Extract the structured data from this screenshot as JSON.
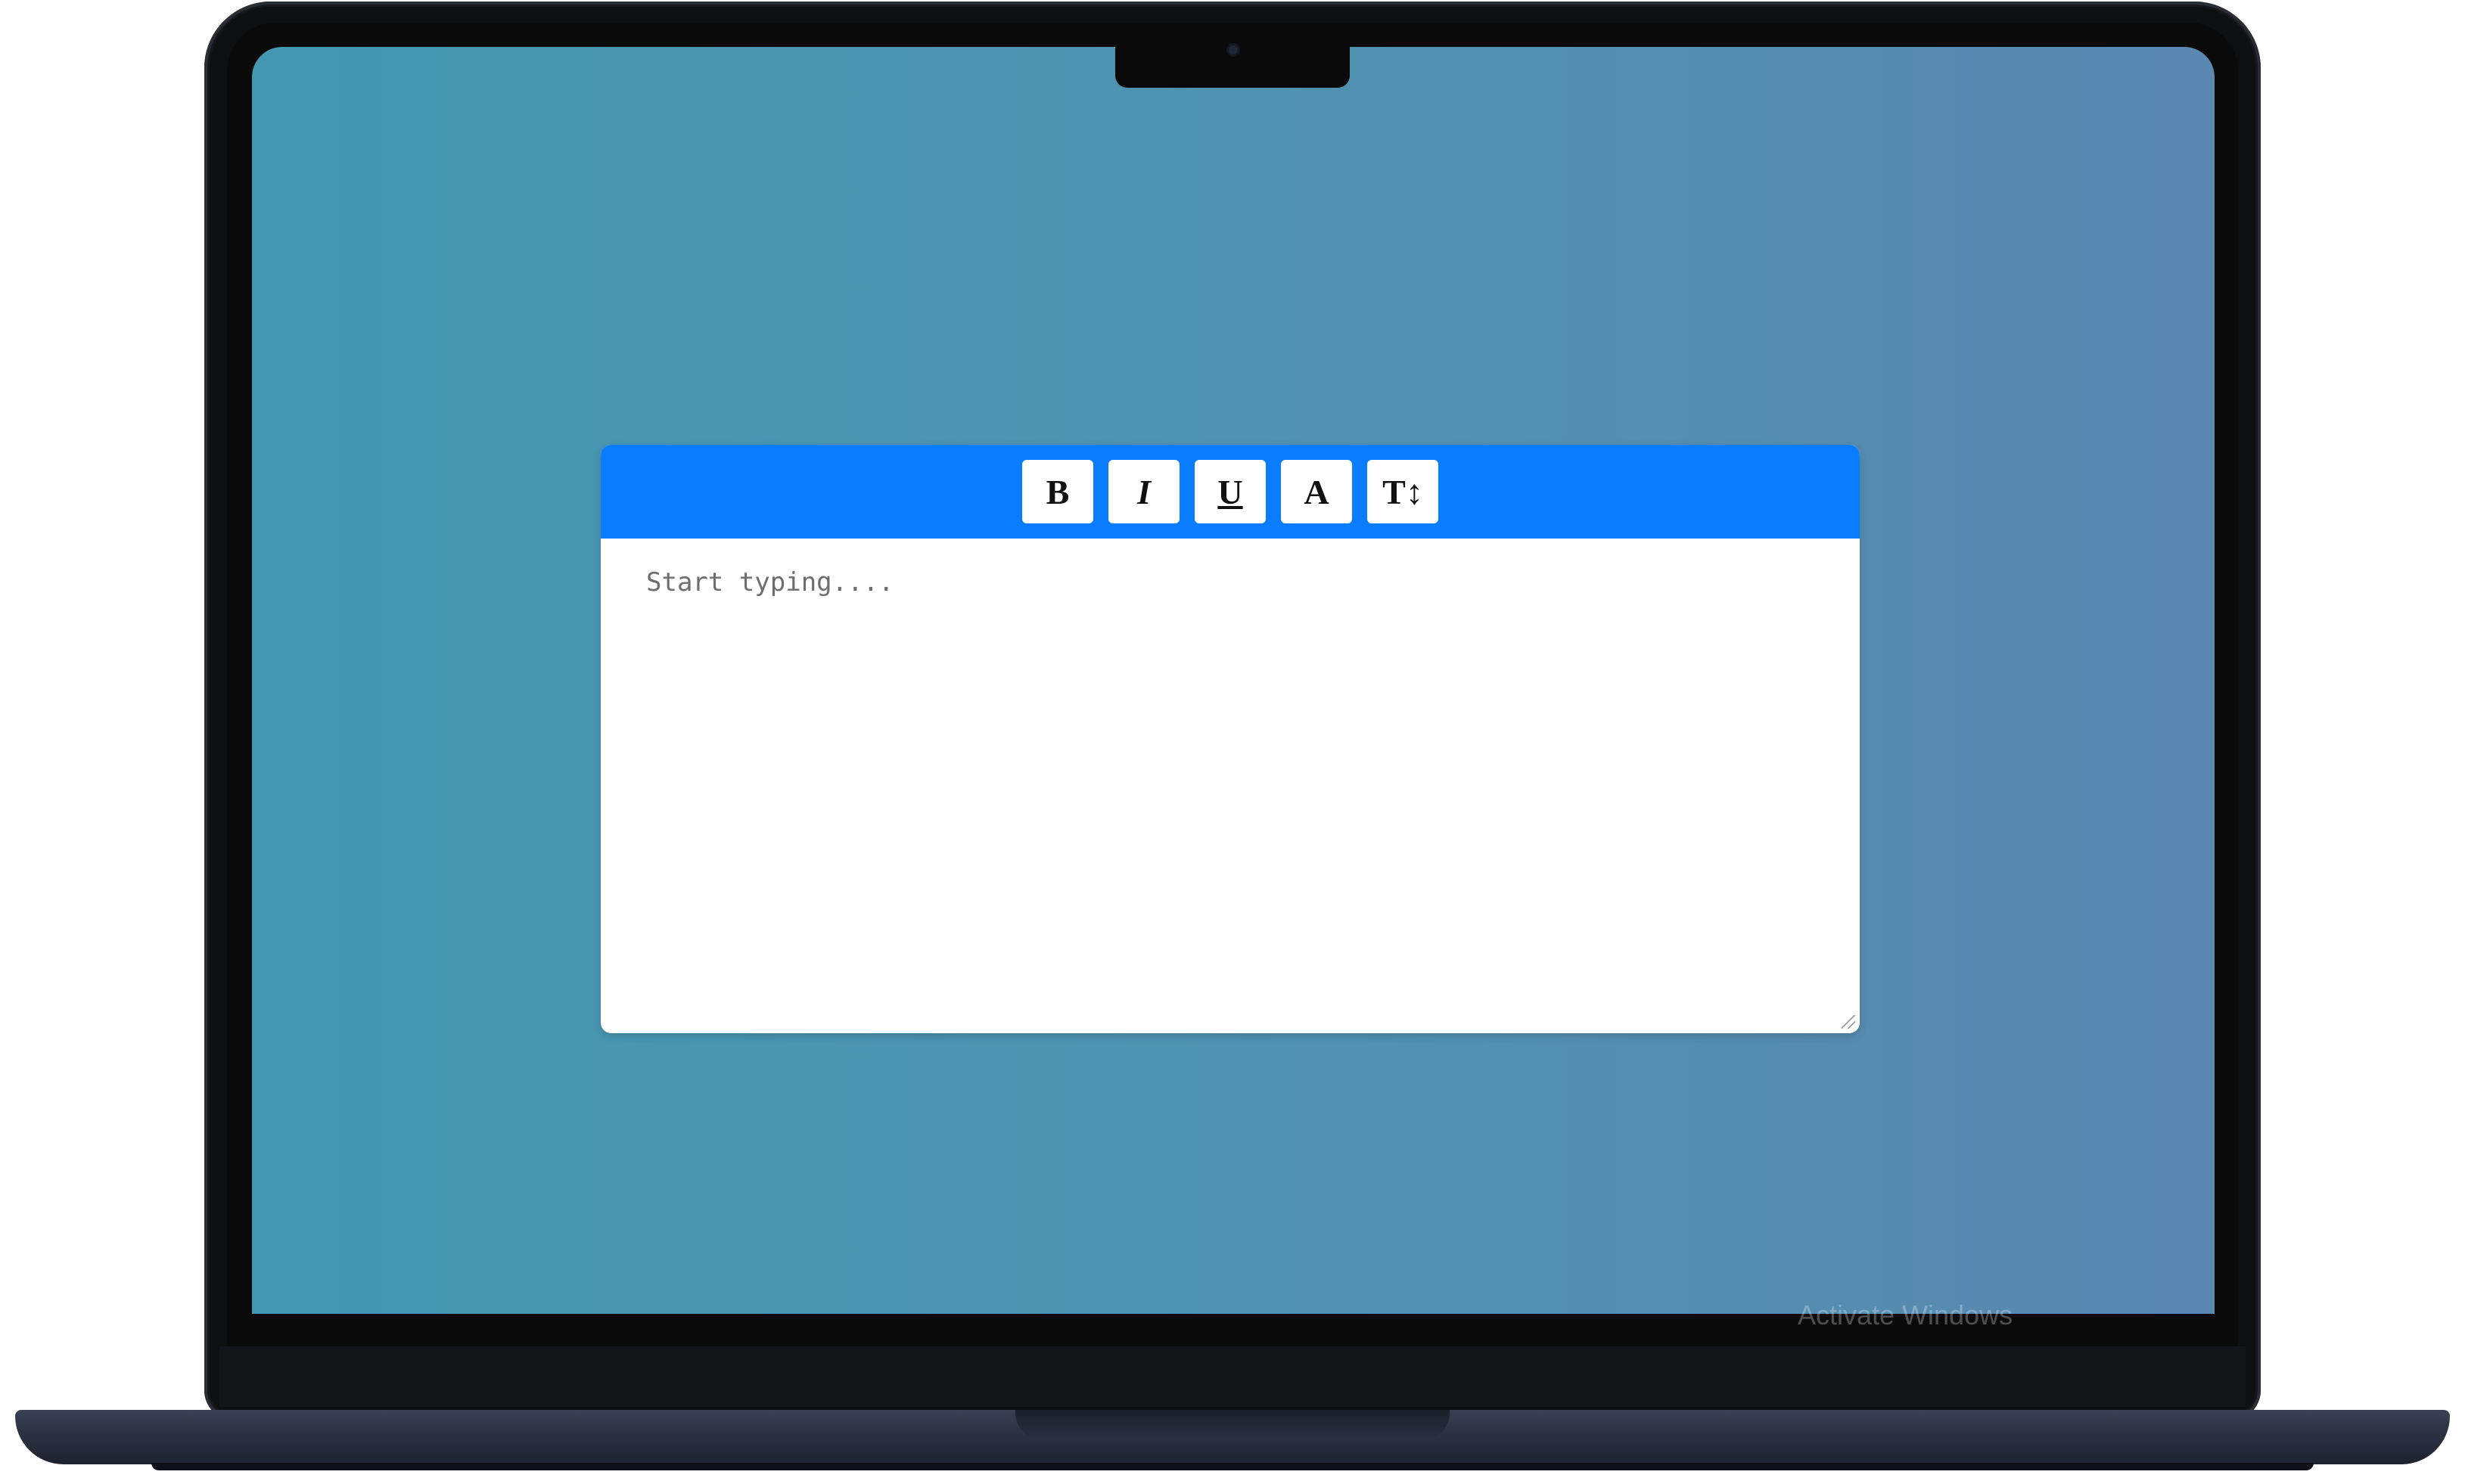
{
  "toolbar": {
    "buttons": [
      {
        "id": "bold",
        "label": "B"
      },
      {
        "id": "italic",
        "label": "I"
      },
      {
        "id": "underline",
        "label": "U"
      },
      {
        "id": "text-color",
        "label": "A"
      },
      {
        "id": "font-size",
        "label": "T↕"
      }
    ]
  },
  "editor": {
    "placeholder": "Start typing...."
  },
  "watermark": {
    "text": "Activate Windows"
  },
  "colors": {
    "toolbar_bg": "#0a7cff",
    "screen_gradient_start": "#4397b0",
    "screen_gradient_end": "#5a88b0"
  }
}
